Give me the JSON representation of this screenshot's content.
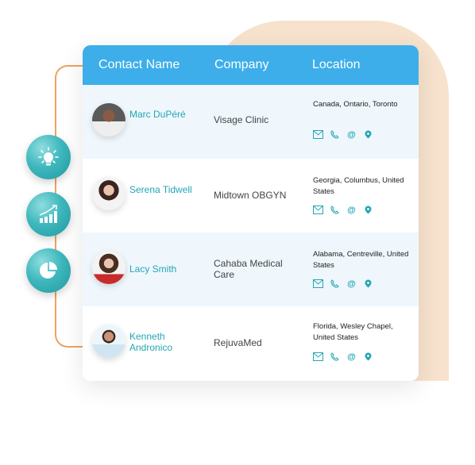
{
  "table": {
    "headers": [
      "Contact Name",
      "Company",
      "Location"
    ],
    "rows": [
      {
        "name": "Marc DuPéré",
        "company": "Visage Clinic",
        "location": "Canada, Ontario, Toronto"
      },
      {
        "name": "Serena Tidwell",
        "company": "Midtown OBGYN",
        "location": "Georgia, Columbus, United States"
      },
      {
        "name": "Lacy Smith",
        "company": "Cahaba Medical Care",
        "location": "Alabama, Centreville, United States"
      },
      {
        "name": "Kenneth Andronico",
        "company": "RejuvaMed",
        "location": "Florida, Wesley Chapel, United States"
      }
    ],
    "row_actions": [
      "envelope-icon",
      "phone-icon",
      "at-sign-icon",
      "map-pin-icon"
    ]
  },
  "side_icons": [
    "lightbulb-icon",
    "growth-chart-icon",
    "pie-chart-icon"
  ],
  "colors": {
    "header_bg": "#3daee9",
    "accent_teal": "#23a6b3",
    "peach": "#f7e2cd",
    "bracket": "#f0a25e"
  }
}
